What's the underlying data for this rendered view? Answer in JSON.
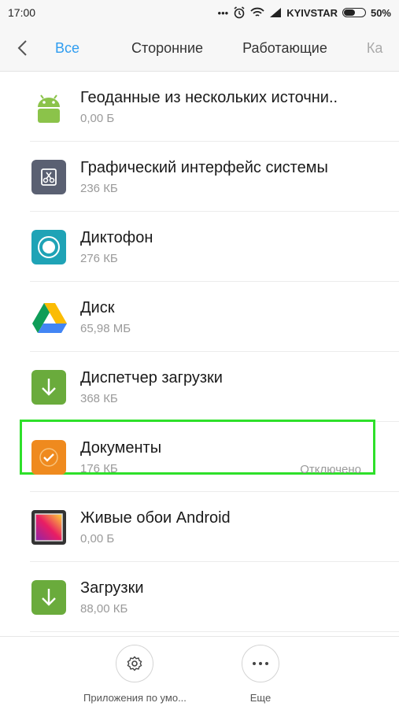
{
  "status_bar": {
    "time": "17:00",
    "carrier": "KYIVSTAR",
    "battery": "50%",
    "battery_level": 0.5
  },
  "tabs": [
    {
      "label": "Все",
      "active": true
    },
    {
      "label": "Сторонние",
      "active": false
    },
    {
      "label": "Работающие",
      "active": false
    },
    {
      "label": "Ка",
      "active": false
    }
  ],
  "apps": [
    {
      "name": "Геоданные из нескольких источни..",
      "size": "0,00 Б",
      "status": "",
      "icon": "android-icon"
    },
    {
      "name": "Графический интерфейс системы",
      "size": "236 КБ",
      "status": "",
      "icon": "system-ui-icon"
    },
    {
      "name": "Диктофон",
      "size": "276 КБ",
      "status": "",
      "icon": "recorder-icon"
    },
    {
      "name": "Диск",
      "size": "65,98 МБ",
      "status": "",
      "icon": "drive-icon"
    },
    {
      "name": "Диспетчер загрузки",
      "size": "368 КБ",
      "status": "",
      "icon": "download-manager-icon"
    },
    {
      "name": "Документы",
      "size": "176 КБ",
      "status": "Отключено",
      "icon": "documents-icon",
      "highlighted": true
    },
    {
      "name": "Живые обои Android",
      "size": "0,00 Б",
      "status": "",
      "icon": "live-wallpaper-icon"
    },
    {
      "name": "Загрузки",
      "size": "88,00 КБ",
      "status": "",
      "icon": "downloads-icon"
    }
  ],
  "bottom_bar": {
    "default_apps_label": "Приложения по умо...",
    "more_label": "Еще"
  },
  "colors": {
    "accent": "#2f9df0",
    "highlight": "#2ee02a"
  }
}
